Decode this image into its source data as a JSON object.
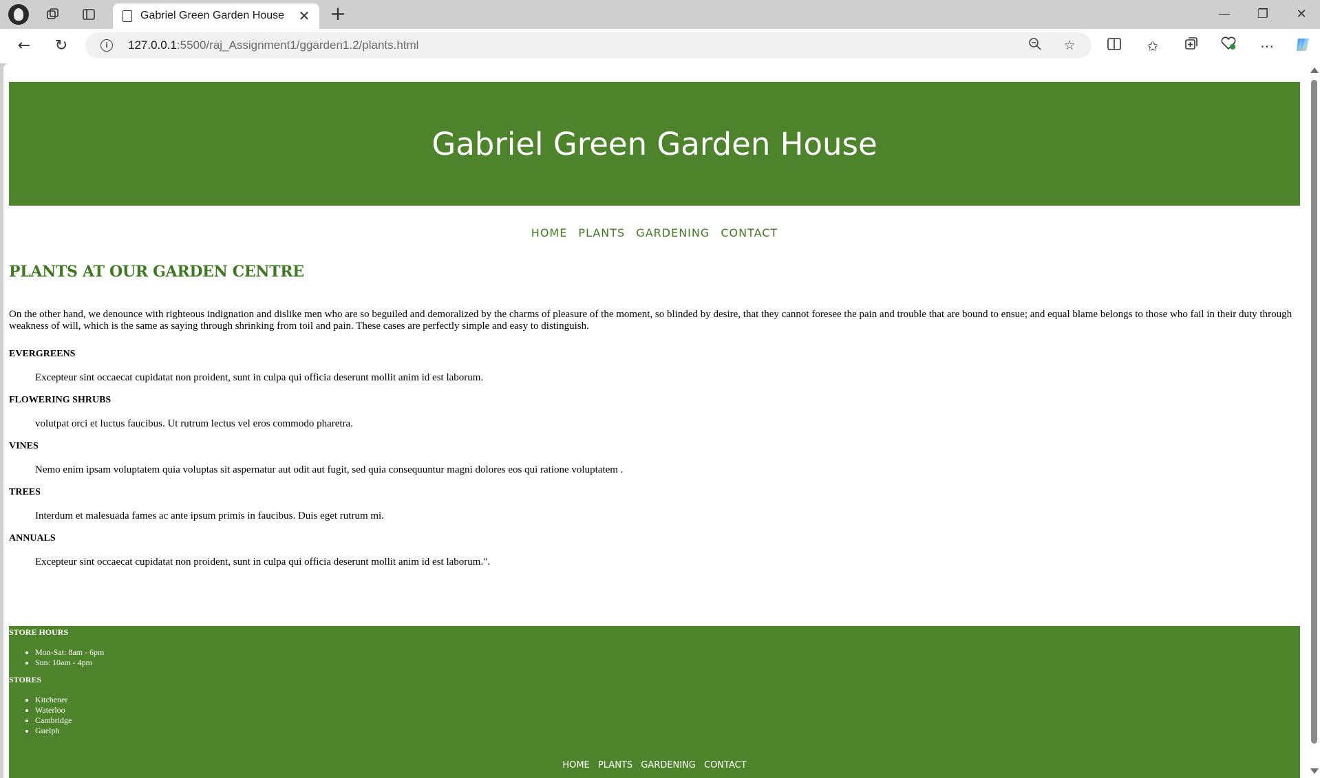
{
  "browser": {
    "tab_title": "Gabriel Green Garden House",
    "url_host": "127.0.0.1",
    "url_rest": ":5500/raj_Assignment1/ggarden1.2/plants.html"
  },
  "site": {
    "title": "Gabriel Green Garden House",
    "nav": [
      "HOME",
      "PLANTS",
      "GARDENING",
      "CONTACT"
    ],
    "heading": "PLANTS AT OUR GARDEN CENTRE",
    "intro": "On the other hand, we denounce with righteous indignation and dislike men who are so beguiled and demoralized by the charms of pleasure of the moment, so blinded by desire, that they cannot foresee the pain and trouble that are bound to ensue; and equal blame belongs to those who fail in their duty through weakness of will, which is the same as saying through shrinking from toil and pain. These cases are perfectly simple and easy to distinguish.",
    "sections": [
      {
        "title": "EVERGREENS",
        "text": "Excepteur sint occaecat cupidatat non proident, sunt in culpa qui officia deserunt mollit anim id est laborum."
      },
      {
        "title": "FLOWERING SHRUBS",
        "text": "volutpat orci et luctus faucibus. Ut rutrum lectus vel eros commodo pharetra."
      },
      {
        "title": "VINES",
        "text": "Nemo enim ipsam voluptatem quia voluptas sit aspernatur aut odit aut fugit, sed quia consequuntur magni dolores eos qui ratione voluptatem ."
      },
      {
        "title": "TREES",
        "text": "Interdum et malesuada fames ac ante ipsum primis in faucibus. Duis eget rutrum mi."
      },
      {
        "title": "ANNUALS",
        "text": "Excepteur sint occaecat cupidatat non proident, sunt in culpa qui officia deserunt mollit anim id est laborum.\"."
      }
    ],
    "footer": {
      "hours_title": "STORE HOURS",
      "hours": [
        "Mon-Sat: 8am - 6pm",
        "Sun: 10am - 4pm"
      ],
      "stores_title": "STORES",
      "stores": [
        "Kitchener",
        "Waterloo",
        "Cambridge",
        "Guelph"
      ],
      "nav": [
        "HOME",
        "PLANTS",
        "GARDENING",
        "CONTACT"
      ]
    },
    "colors": {
      "brand_green": "#4d832b",
      "link_green": "#3f7a22"
    }
  }
}
